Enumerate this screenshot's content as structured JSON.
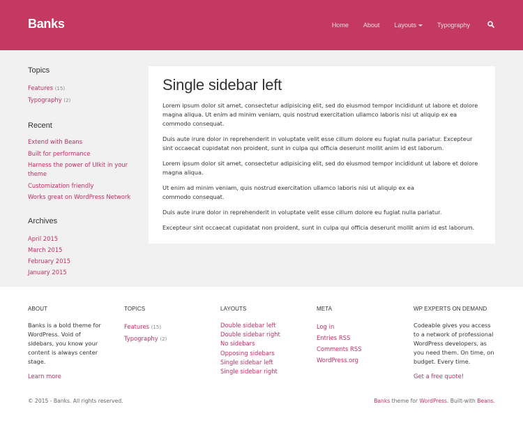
{
  "header": {
    "logo": "Banks",
    "nav": [
      "Home",
      "About",
      "Layouts",
      "Typography"
    ],
    "accent_color": "#c3395f"
  },
  "sidebar": {
    "topics": {
      "title": "Topics",
      "items": [
        {
          "label": "Features",
          "count": "(15)"
        },
        {
          "label": "Typography",
          "count": "(2)"
        }
      ]
    },
    "recent": {
      "title": "Recent",
      "items": [
        "Extend with Beans",
        "Built for performance",
        "Harness the power of UIkit in your theme",
        "Customization friendly",
        "Works great on WordPress Network"
      ]
    },
    "archives": {
      "title": "Archives",
      "items": [
        "April 2015",
        "March 2015",
        "February 2015",
        "January 2015"
      ]
    }
  },
  "article": {
    "title": "Single sidebar left",
    "paragraphs": [
      "Lorem ipsum dolor sit amet, consectetur adipisicing elit, sed do eiusmod tempor incididunt ut labore et dolore magna aliqua. Ut enim ad minim veniam, quis nostrud exercitation ullamco laboris nisi ut aliquip ex ea commodo consequat.",
      "Duis aute irure dolor in reprehenderit in voluptate velit esse cillum dolore eu fugiat nulla pariatur. Excepteur sint occaecat cupidatat non proident, sunt in culpa qui officia deserunt mollit anim id est laborum.",
      "Lorem ipsum dolor sit amet, consectetur adipisicing elit, sed do eiusmod tempor incididunt ut labore et dolore magna aliqua.",
      "Ut enim ad minim veniam, quis nostrud exercitation ullamco laboris nisi ut aliquip ex ea commodo consequat.",
      "Duis aute irure dolor in reprehenderit in voluptate velit esse cillum dolore eu fugiat nulla pariatur.",
      "Excepteur sint occaecat cupidatat non proident, sunt in culpa qui officia deserunt mollit anim id est laborum."
    ]
  },
  "footer": {
    "about": {
      "title": "About",
      "text": "Banks is a bold theme for WordPress. Void of sidebars, you know your content is always center stage.",
      "link": "Learn more"
    },
    "topics": {
      "title": "Topics",
      "items": [
        {
          "label": "Features",
          "count": "(15)"
        },
        {
          "label": "Typography",
          "count": "(2)"
        }
      ]
    },
    "layouts": {
      "title": "Layouts",
      "items": [
        "Double sidebar left",
        "Double sidebar right",
        "No sidebars",
        "Opposing sidebars",
        "Single sidebar left",
        "Single sidebar right"
      ]
    },
    "meta": {
      "title": "Meta",
      "items": [
        "Log in",
        "Entries RSS",
        "Comments RSS",
        "WordPress.org"
      ]
    },
    "experts": {
      "title": "WP Experts on Demand",
      "text": "Codeable gives you access to a network of professional WordPress developers, as you need them. On time, on budget. Every time.",
      "link": "Get a free quote!"
    },
    "copyright": "© 2015 - Banks. All rights reserved.",
    "credits": {
      "banks": "Banks",
      "theme_for": " theme for ",
      "wordpress": "WordPress",
      "built_with": ". Built-with ",
      "beans": "Beans",
      "end": "."
    }
  }
}
